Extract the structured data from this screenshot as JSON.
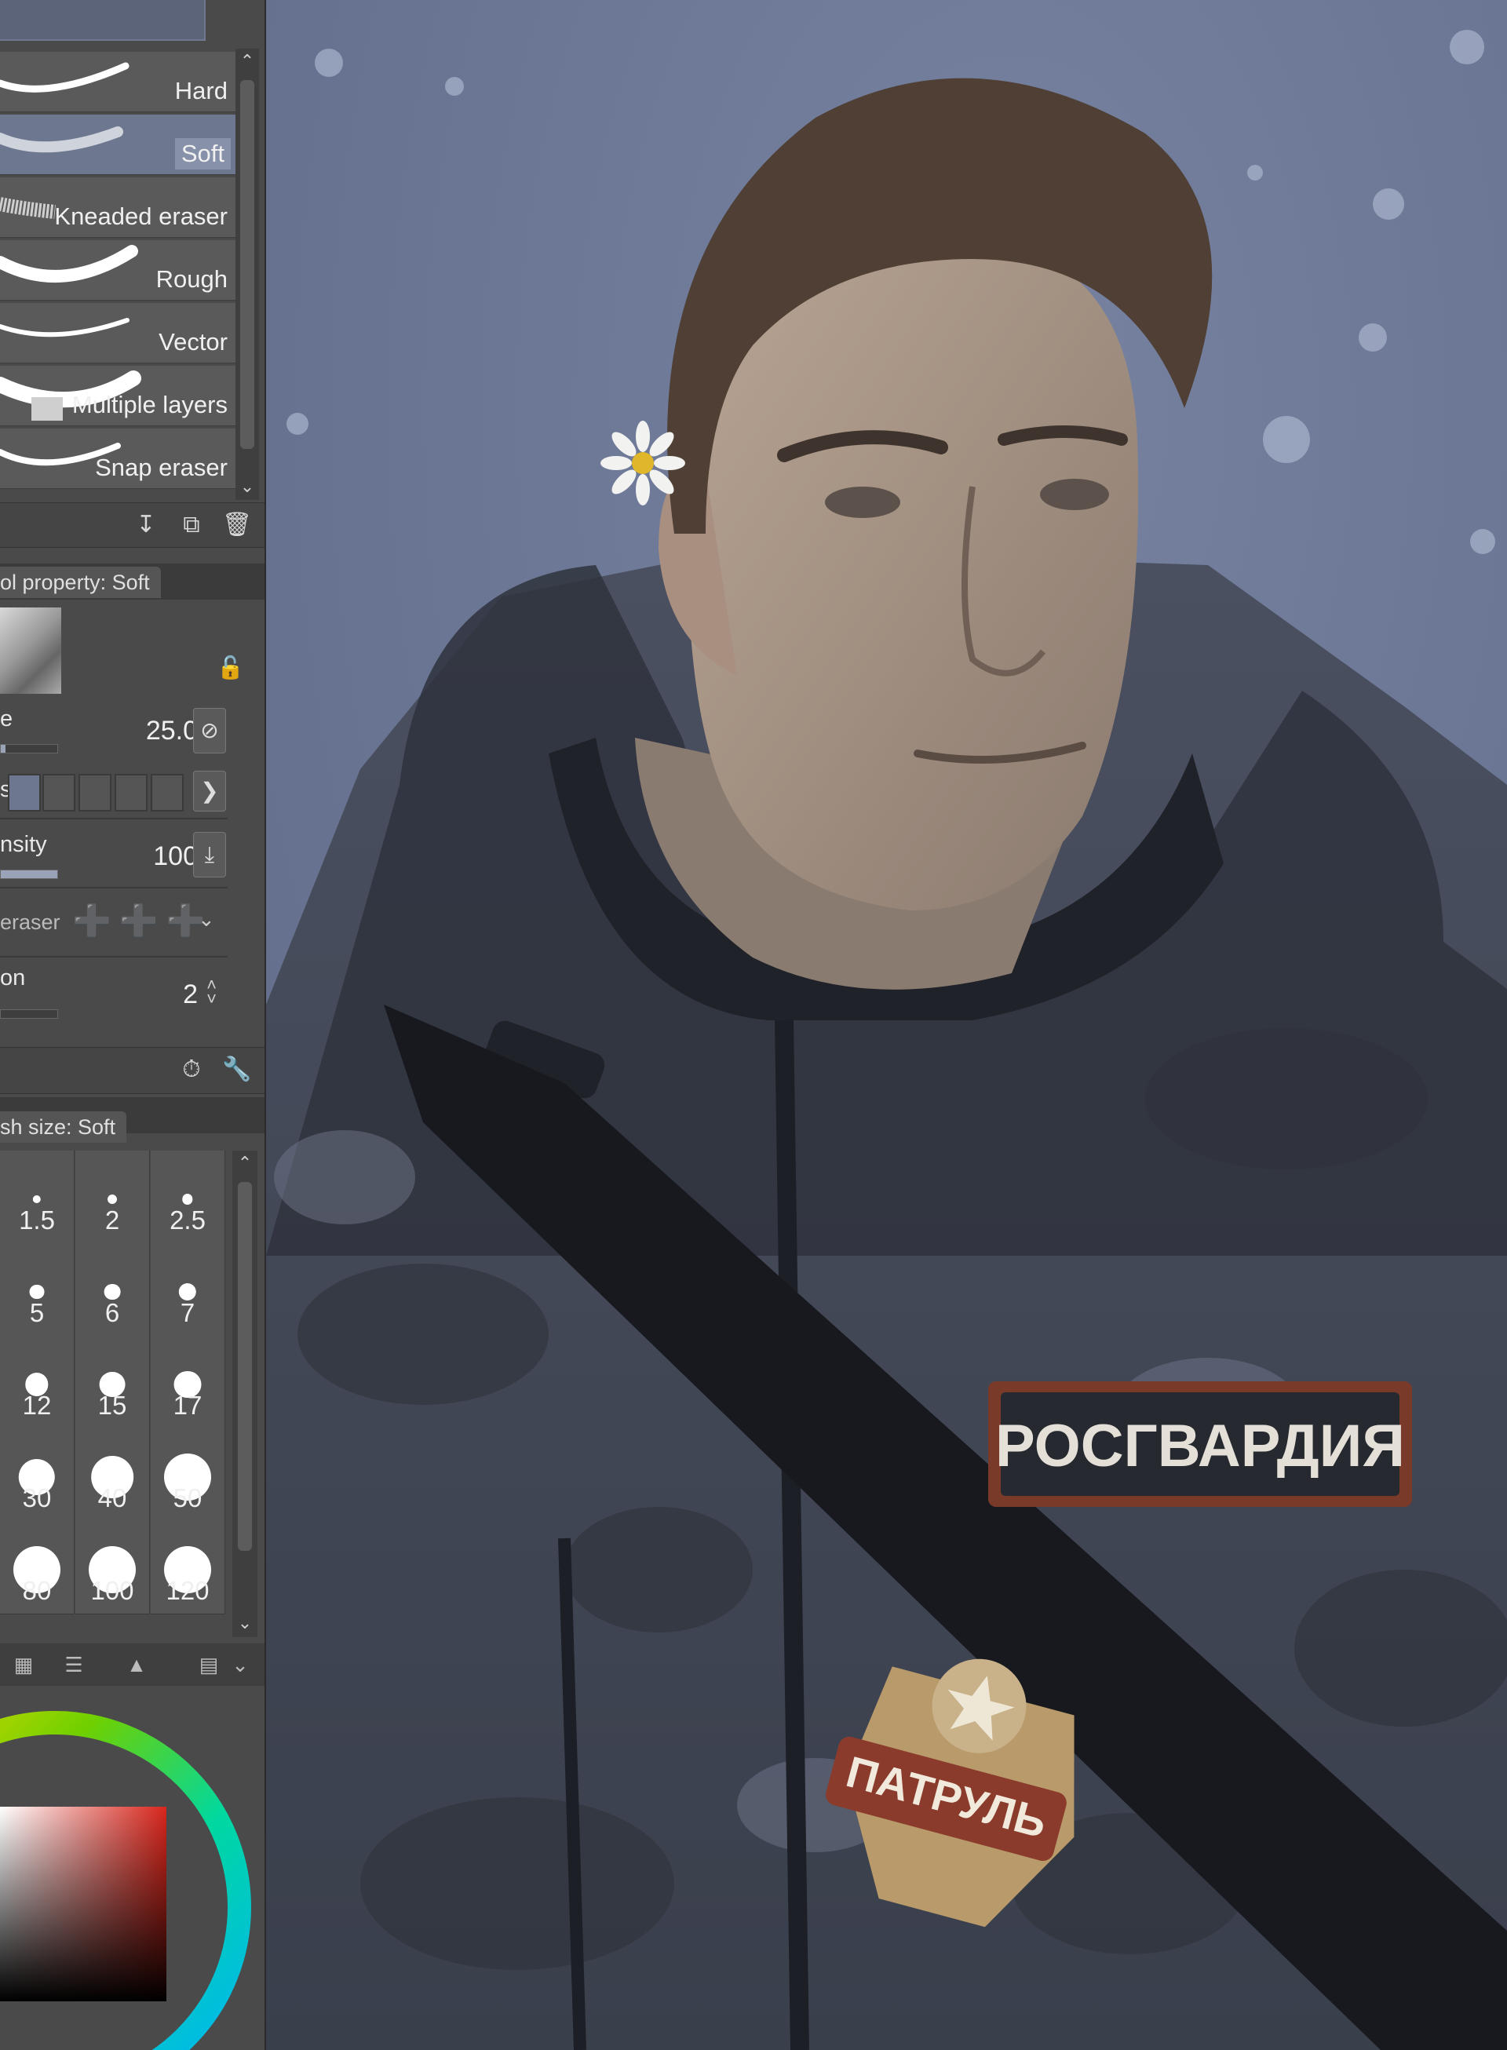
{
  "brushes": [
    {
      "label": "Hard"
    },
    {
      "label": "Soft",
      "selected": true
    },
    {
      "label": "Kneaded eraser"
    },
    {
      "label": "Rough"
    },
    {
      "label": "Vector"
    },
    {
      "label": "Multiple layers"
    },
    {
      "label": "Snap eraser"
    }
  ],
  "tool_property": {
    "tab_title": "ol property: Soft",
    "size_label": "e",
    "size_value": "25.0",
    "hardness_label": "s",
    "density_label": "nsity",
    "density_value": "100",
    "eraser_label": "eraser",
    "correction_label": "on",
    "correction_value": "2",
    "size_fill_fraction": 0.08,
    "density_fill_fraction": 1.0
  },
  "brush_size": {
    "tab_title": "sh size: Soft",
    "sizes": [
      "1.5",
      "2",
      "2.5",
      "5",
      "6",
      "7",
      "12",
      "15",
      "17",
      "30",
      "40",
      "50",
      "80",
      "100",
      "120"
    ]
  },
  "icons": {
    "list_actions": [
      "import-icon",
      "duplicate-icon",
      "trash-icon"
    ],
    "property_actions": [
      "dial-icon",
      "wrench-icon"
    ]
  },
  "canvas": {
    "patch_text": "РОСГВАРДИЯ",
    "badge_text": "ПАТРУЛЬ"
  },
  "colors": {
    "accent": "#6d778f",
    "sky": "#6b7793",
    "main_color": "#d8261c"
  }
}
